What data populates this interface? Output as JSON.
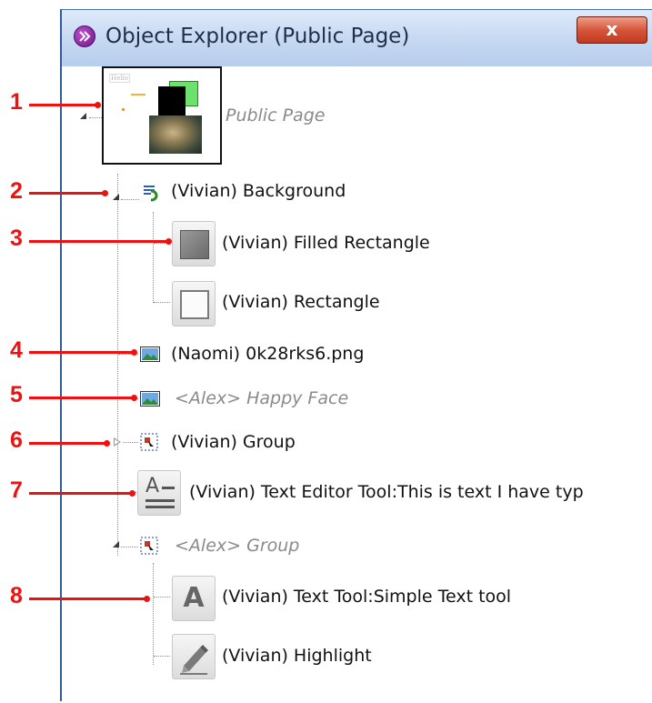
{
  "window": {
    "title": "Object Explorer (Public Page)",
    "close_label": "x"
  },
  "tree": {
    "root": {
      "label": "Public Page",
      "thumb_text": "Hello"
    },
    "items": [
      {
        "label": "(Vivian) Background",
        "icon": "background-icon"
      },
      {
        "label": "(Vivian) Filled Rectangle",
        "icon": "filled-rectangle-icon"
      },
      {
        "label": "(Vivian) Rectangle",
        "icon": "rectangle-icon"
      },
      {
        "label": "(Naomi) 0k28rks6.png",
        "icon": "image-icon"
      },
      {
        "label": "<Alex> Happy Face",
        "icon": "image-icon",
        "ghost": true
      },
      {
        "label": "(Vivian) Group",
        "icon": "group-icon"
      },
      {
        "label": "(Vivian) Text Editor Tool:This is text I have typ",
        "icon": "text-editor-icon"
      },
      {
        "label": "<Alex> Group",
        "icon": "group-icon",
        "ghost": true
      },
      {
        "label": "(Vivian) Text Tool:Simple Text tool",
        "icon": "text-tool-icon"
      },
      {
        "label": "(Vivian) Highlight",
        "icon": "highlight-icon"
      }
    ]
  },
  "callouts": [
    "1",
    "2",
    "3",
    "4",
    "5",
    "6",
    "7",
    "8"
  ],
  "colors": {
    "callout": "#ee1111",
    "title_bar": "#c9dbf3",
    "close_button": "#d6553a"
  }
}
